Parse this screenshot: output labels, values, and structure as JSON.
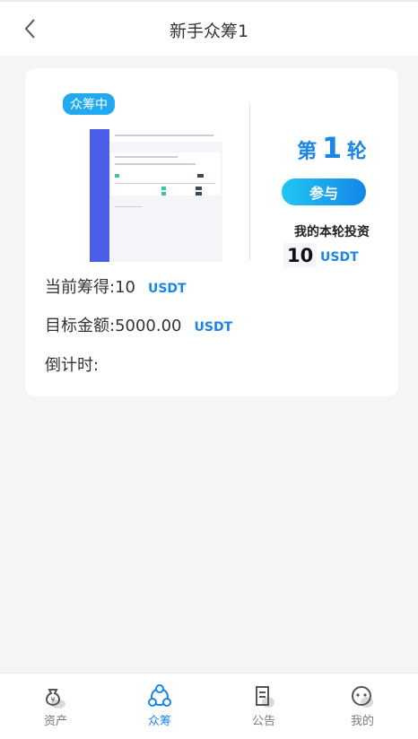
{
  "header": {
    "title": "新手众筹1"
  },
  "project": {
    "badge": "众筹中",
    "round": {
      "prefix": "第",
      "number": "1",
      "suffix": "轮"
    },
    "join_label": "参与",
    "my_investment_label": "我的本轮投资",
    "my_investment_value": "10",
    "currency": "USDT",
    "raised": {
      "label": "当前筹得:",
      "value": "10",
      "unit": "USDT"
    },
    "target": {
      "label": "目标金额:",
      "value": "5000.00",
      "unit": "USDT"
    },
    "countdown": {
      "label": "倒计时:"
    }
  },
  "tabbar": {
    "items": [
      {
        "label": "资产",
        "icon": "money-bag-icon",
        "active": false
      },
      {
        "label": "众筹",
        "icon": "crowdfund-icon",
        "active": true
      },
      {
        "label": "公告",
        "icon": "document-icon",
        "active": false
      },
      {
        "label": "我的",
        "icon": "profile-icon",
        "active": false
      }
    ]
  },
  "colors": {
    "accent": "#1a85e6",
    "badge": "#23a8f2",
    "background": "#f4f5f7"
  }
}
